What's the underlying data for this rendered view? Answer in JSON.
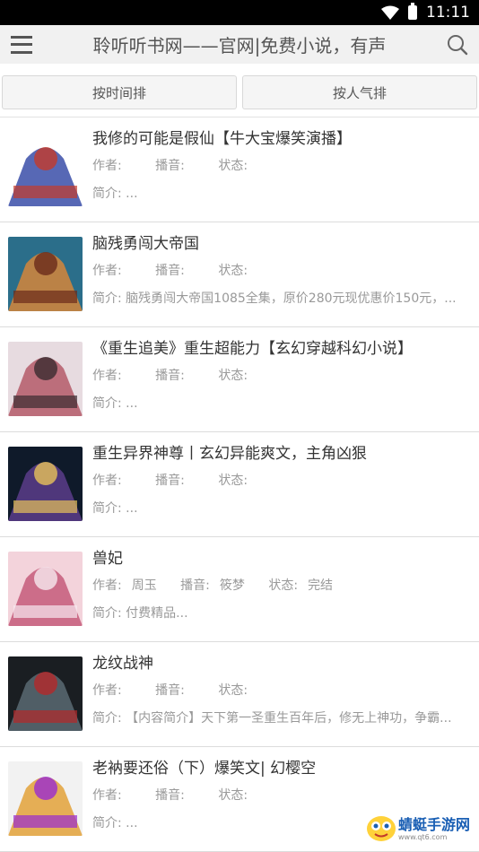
{
  "status_bar": {
    "time": "11:11"
  },
  "header": {
    "title": "聆听听书网——官网|免费小说，有声",
    "menu_icon": "hamburger-menu-icon",
    "search_icon": "search-icon"
  },
  "tabs": [
    {
      "label": "按时间排"
    },
    {
      "label": "按人气排"
    }
  ],
  "labels": {
    "author": "作者:",
    "narrator": "播音:",
    "status": "状态:",
    "intro": "简介:"
  },
  "books": [
    {
      "title": "我修的可能是假仙【牛大宝爆笑演播】",
      "author": "",
      "narrator": "",
      "status": "",
      "intro": "...",
      "cover_colors": [
        "#ffffff",
        "#3a4ea8",
        "#c43a2a"
      ]
    },
    {
      "title": "脑残勇闯大帝国",
      "author": "",
      "narrator": "",
      "status": "",
      "intro": "脑残勇闯大帝国1085全集，原价280元现优惠价150元，...",
      "cover_colors": [
        "#2b6e8a",
        "#d5863a",
        "#6a2a1a"
      ]
    },
    {
      "title": "《重生追美》重生超能力【玄幻穿越科幻小说】",
      "author": "",
      "narrator": "",
      "status": "",
      "intro": "...",
      "cover_colors": [
        "#e7dbe0",
        "#b45a68",
        "#3a2b30"
      ]
    },
    {
      "title": "重生异界神尊丨玄幻异能爽文，主角凶狠",
      "author": "",
      "narrator": "",
      "status": "",
      "intro": "...",
      "cover_colors": [
        "#0f1a2a",
        "#5a3d8a",
        "#e7c25a"
      ]
    },
    {
      "title": "兽妃",
      "author": "周玉",
      "narrator": "筱梦",
      "status": "完结",
      "intro": "付费精品...",
      "cover_colors": [
        "#f3d3db",
        "#c45a7a",
        "#f6e8ef"
      ]
    },
    {
      "title": "龙纹战神",
      "author": "",
      "narrator": "",
      "status": "",
      "intro": "【内容简介】天下第一圣重生百年后，修无上神功，争霸...",
      "cover_colors": [
        "#1a1e22",
        "#5a6a72",
        "#b4282a"
      ]
    },
    {
      "title": "老衲要还俗（下）爆笑文| 幻樱空",
      "author": "",
      "narrator": "",
      "status": "",
      "intro": "...",
      "cover_colors": [
        "#f2f2f2",
        "#e3a23a",
        "#9a2ad0"
      ]
    }
  ],
  "watermark": {
    "name": "蜻蜓手游网",
    "url": "www.qt6.com"
  }
}
